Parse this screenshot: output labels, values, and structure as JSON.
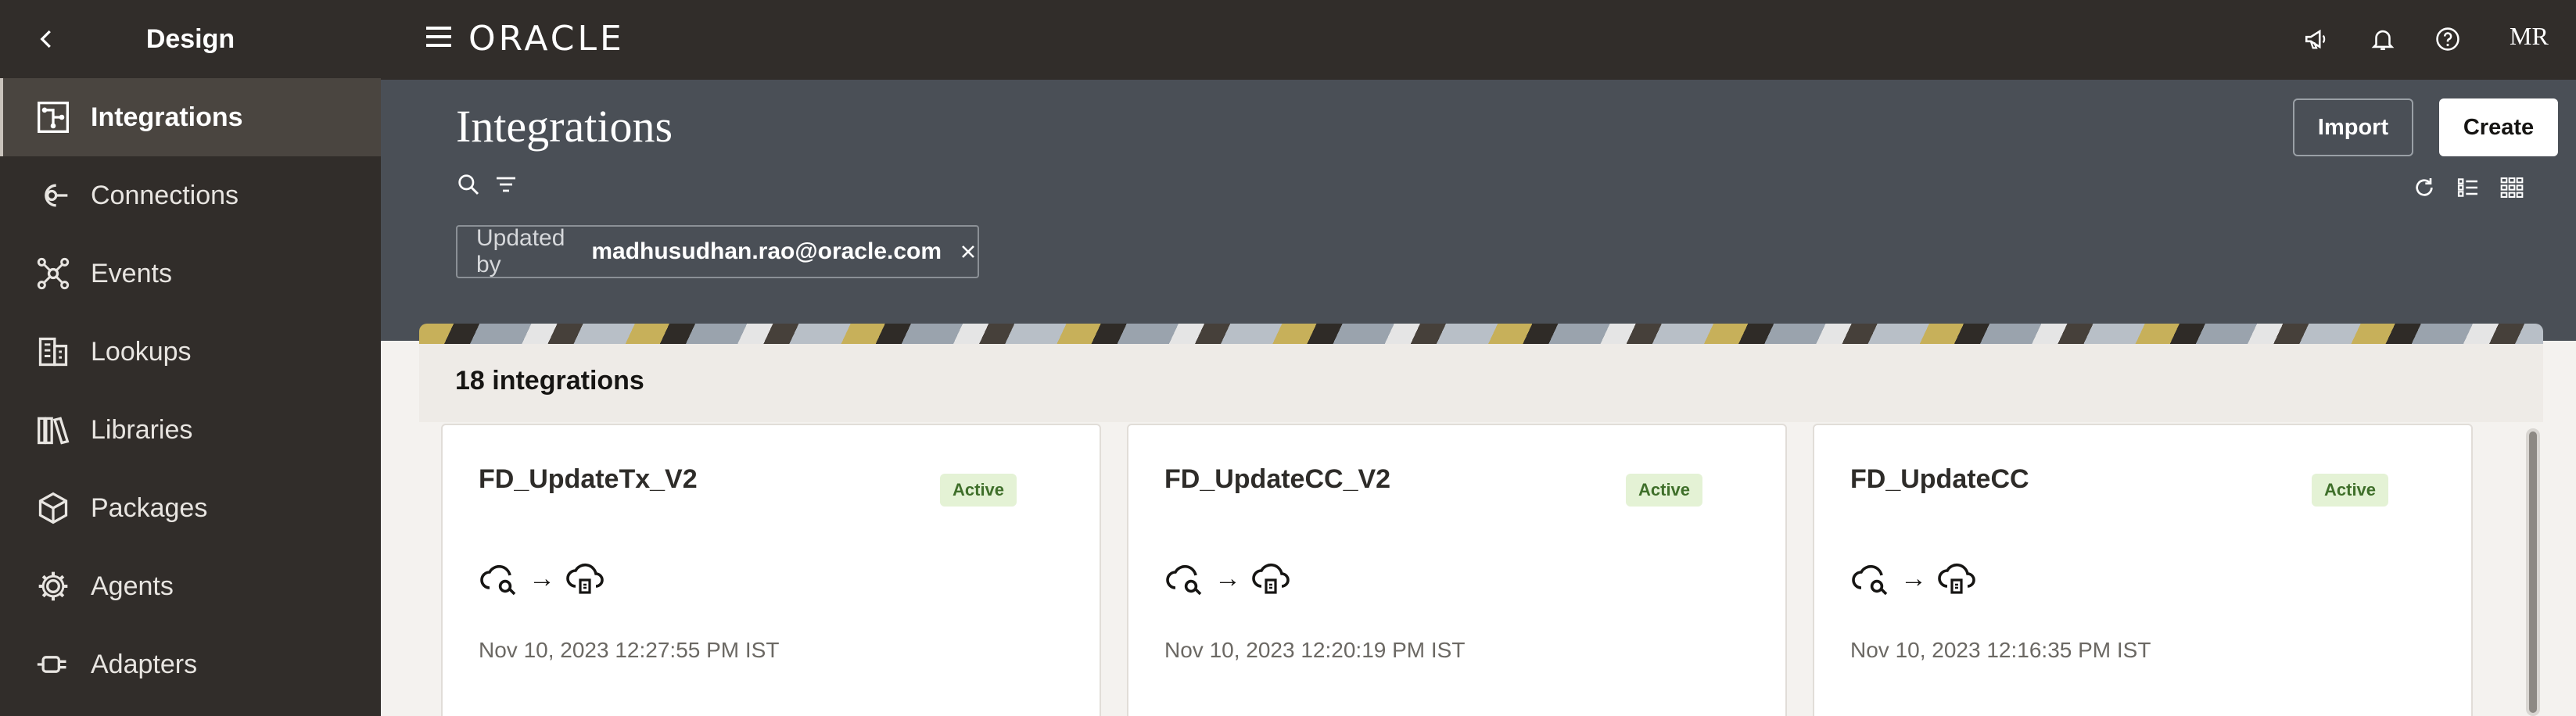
{
  "sidebar": {
    "title": "Design",
    "items": [
      {
        "label": "Integrations",
        "icon": "integrations-icon",
        "active": true
      },
      {
        "label": "Connections",
        "icon": "connections-icon"
      },
      {
        "label": "Events",
        "icon": "events-icon"
      },
      {
        "label": "Lookups",
        "icon": "lookups-icon"
      },
      {
        "label": "Libraries",
        "icon": "libraries-icon"
      },
      {
        "label": "Packages",
        "icon": "packages-icon"
      },
      {
        "label": "Agents",
        "icon": "agents-icon"
      },
      {
        "label": "Adapters",
        "icon": "adapters-icon"
      }
    ]
  },
  "topbar": {
    "logo": "ORACLE",
    "avatar": "MR"
  },
  "page": {
    "title": "Integrations",
    "import_label": "Import",
    "create_label": "Create"
  },
  "filter_chip": {
    "label": "Updated by",
    "value": "madhusudhan.rao@oracle.com"
  },
  "results": {
    "count_label": "18 integrations"
  },
  "cards": [
    {
      "name": "FD_UpdateTx_V2",
      "status": "Active",
      "updated": "Nov 10, 2023 12:27:55 PM IST"
    },
    {
      "name": "FD_UpdateCC_V2",
      "status": "Active",
      "updated": "Nov 10, 2023 12:20:19 PM IST"
    },
    {
      "name": "FD_UpdateCC",
      "status": "Active",
      "updated": "Nov 10, 2023 12:16:35 PM IST"
    }
  ],
  "colors": {
    "sidebar_bg": "#312d2a",
    "header_bg": "#4a4f56",
    "active_badge_bg": "#e4f2d5",
    "active_badge_text": "#3f6f2a"
  }
}
